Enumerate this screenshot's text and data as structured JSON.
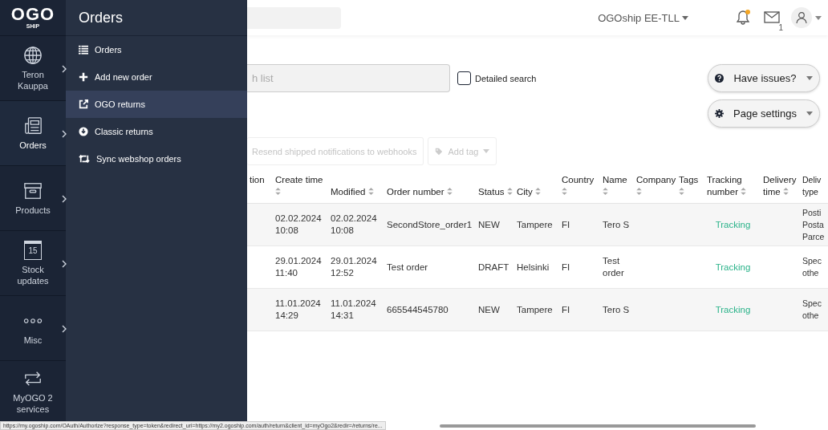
{
  "logo": {
    "text": "OGO",
    "sub": "SHIP"
  },
  "rail": [
    {
      "label": "Teron Kauppa",
      "selected": false,
      "submenu": true
    },
    {
      "label": "Orders",
      "selected": true,
      "submenu": true
    },
    {
      "label": "Products",
      "selected": false,
      "submenu": true
    },
    {
      "label": "Stock updates",
      "icon_label": "15",
      "selected": false,
      "submenu": true
    },
    {
      "label": "Misc",
      "selected": false,
      "submenu": true
    },
    {
      "label": "MyOGO 2 services",
      "selected": false,
      "submenu": false
    }
  ],
  "flyout": {
    "title": "Orders",
    "items": [
      {
        "label": "Orders",
        "selected": false
      },
      {
        "label": "Add new order",
        "selected": false
      },
      {
        "label": "OGO returns",
        "selected": true
      },
      {
        "label": "Classic returns",
        "selected": false
      },
      {
        "label": "Sync webshop orders",
        "selected": false
      }
    ]
  },
  "header": {
    "warehouse": "OGOship EE-TLL",
    "notifications": true,
    "messages_count": "1"
  },
  "search": {
    "placeholder": "h list"
  },
  "detailed_search": {
    "label": "Detailed search",
    "checked": false
  },
  "side_buttons": [
    {
      "label": "Have issues?"
    },
    {
      "label": "Page settings"
    }
  ],
  "actions": [
    {
      "label": "Resend shipped notifications to webhooks",
      "disabled": true,
      "dropdown": false
    },
    {
      "label": "Add tag",
      "disabled": true,
      "dropdown": true
    }
  ],
  "table": {
    "columns": [
      {
        "label": "tion",
        "sortable": false
      },
      {
        "label": "Create time",
        "sortable": true
      },
      {
        "label": "Modified",
        "sortable": true
      },
      {
        "label": "Order number",
        "sortable": true
      },
      {
        "label": "Status",
        "sortable": true
      },
      {
        "label": "City",
        "sortable": true
      },
      {
        "label": "Country",
        "sortable": true
      },
      {
        "label": "Name",
        "sortable": true
      },
      {
        "label": "Company",
        "sortable": true
      },
      {
        "label": "Tags",
        "sortable": true
      },
      {
        "label": "Tracking number",
        "sortable": true
      },
      {
        "label": "Delivery time",
        "sortable": true
      },
      {
        "label": "Deliv type",
        "sortable": false
      }
    ],
    "rows": [
      {
        "cells": [
          "",
          "02.02.2024 10:08",
          "02.02.2024 10:08",
          "SecondStore_order1",
          "NEW",
          "Tampere",
          "FI",
          "Tero S",
          "",
          "",
          "Tracking",
          "",
          "Posti Posta Parce"
        ]
      },
      {
        "cells": [
          "",
          "29.01.2024 11:40",
          "29.01.2024 12:52",
          "Test order",
          "DRAFT",
          "Helsinki",
          "FI",
          "Test order",
          "",
          "",
          "Tracking",
          "",
          "Spec othe"
        ]
      },
      {
        "cells": [
          "",
          "11.01.2024 14:29",
          "11.01.2024 14:31",
          "665544545780",
          "NEW",
          "Tampere",
          "FI",
          "Tero S",
          "",
          "",
          "Tracking",
          "",
          "Spec othe"
        ]
      }
    ]
  },
  "status_bar": {
    "url": "https://my.ogoship.com/OAuth/Authorize?response_type=token&redirect_uri=https://my2.ogoship.com/auth/return&client_id=myOgo2&redir=/returns/re..."
  }
}
